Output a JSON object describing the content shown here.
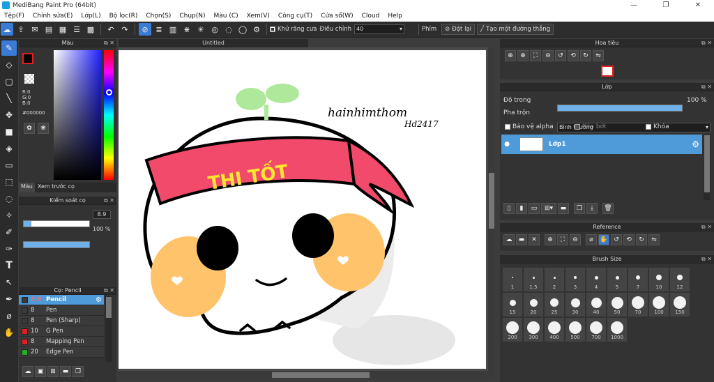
{
  "window": {
    "title": "MediBang Paint Pro (64bit)"
  },
  "menu": [
    "Tệp(F)",
    "Chỉnh sửa(E)",
    "Lớp(L)",
    "Bộ lọc(R)",
    "Chọn(S)",
    "Chụp(N)",
    "Màu (C)",
    "Xem(V)",
    "Công cụ(T)",
    "Cửa sổ(W)",
    "Cloud",
    "Help"
  ],
  "toolbar": {
    "antialias_label": "Khử răng cưa",
    "adjust_label": "Điều chỉnh",
    "adjust_value": "40",
    "phim_label": "Phím",
    "reset_label": "Đặt lại",
    "make_line_label": "Tạo một đường thẳng"
  },
  "color_panel": {
    "title": "Màu",
    "r": "R:0",
    "g": "G:0",
    "b": "B:0",
    "hex": "#000000",
    "tab_color": "Màu",
    "tab_preview": "Xem trước cọ",
    "foreground": "#000000"
  },
  "brush_control": {
    "title": "Kiểm soát cọ",
    "size": "8.9",
    "size_fraction": 0.12,
    "opacity": "100 %",
    "opacity_fraction": 1.0
  },
  "brush_list": {
    "title": "Cọ: Pencil",
    "items": [
      {
        "size": "8.9",
        "name": "Pencil",
        "color": "#3a3a3a"
      },
      {
        "size": "8",
        "name": "Pen",
        "color": "#3a3a3a"
      },
      {
        "size": "8",
        "name": "Pen (Sharp)",
        "color": "#3a3a3a"
      },
      {
        "size": "10",
        "name": "G Pen",
        "color": "#e02020"
      },
      {
        "size": "8",
        "name": "Mapping Pen",
        "color": "#e02020"
      },
      {
        "size": "20",
        "name": "Edge Pen",
        "color": "#20b020"
      }
    ]
  },
  "canvas": {
    "tab_title": "Untitled",
    "headband_text": "THI TỐT",
    "signature_line1": "hainhimthom",
    "signature_line2": "Hd2417"
  },
  "navigator": {
    "title": "Hoa tiêu"
  },
  "layer_panel": {
    "title": "Lớp",
    "opacity_label": "Độ trong",
    "opacity_value": "100 %",
    "opacity_fraction": 1.0,
    "blend_label": "Pha trộn",
    "blend_value": "Bình thường",
    "protect_alpha": "Bảo vệ alpha",
    "clipping": "Xén bớt",
    "lock": "Khóa",
    "layer_name": "Lớp1"
  },
  "reference": {
    "title": "Reference"
  },
  "brush_size": {
    "title": "Brush Size",
    "sizes": [
      "1",
      "1.5",
      "2",
      "3",
      "4",
      "5",
      "7",
      "10",
      "12",
      "15",
      "20",
      "25",
      "30",
      "40",
      "50",
      "70",
      "100",
      "150",
      "200",
      "300",
      "400",
      "500",
      "700",
      "1000"
    ]
  }
}
